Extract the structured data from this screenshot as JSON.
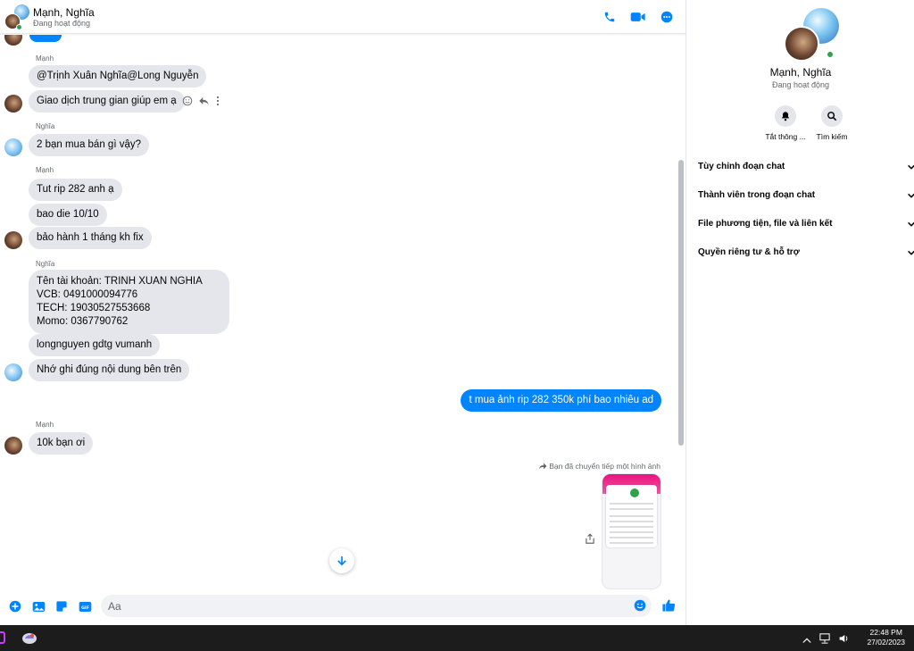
{
  "header": {
    "title": "Mạnh, Nghĩa",
    "status": "Đang hoạt động"
  },
  "messages": {
    "sender_manh": "Mạnh",
    "sender_nghia": "Nghĩa",
    "m1": "@Trịnh Xuân Nghĩa@Long Nguyễn",
    "m2": "Giao dịch trung gian giúp em ạ",
    "m3": "2 bạn mua bán gì vậy?",
    "m4": "Tut rip 282 anh ạ",
    "m5": "bao die 10/10",
    "m6": "bảo hành 1 tháng kh fix",
    "m7": "Tên tài khoản: TRINH XUAN NGHIA\nVCB: 0491000094776\nTECH: 19030527553668\nMomo: 0367790762",
    "m8": "longnguyen gdtg vumanh",
    "m9": "Nhớ ghi đúng nội dung bên trên",
    "m10": "t mua ảnh rip 282 350k phí bao nhiêu ad",
    "m11": "10k bạn ơi",
    "forward_note": "Bạn đã chuyển tiếp một hình ảnh"
  },
  "composer": {
    "placeholder": "Aa"
  },
  "panel": {
    "name": "Mạnh, Nghĩa",
    "status": "Đang hoạt động",
    "mute_label": "Tắt thông ...",
    "search_label": "Tìm kiếm",
    "menu": [
      "Tùy chỉnh đoạn chat",
      "Thành viên trong đoạn chat",
      "File phương tiện, file và liên kết",
      "Quyền riêng tư & hỗ trợ"
    ]
  },
  "taskbar": {
    "time": "22:48 PM",
    "date": "27/02/2023"
  },
  "colors": {
    "accent": "#0084ff",
    "bubble_other": "#e4e6eb",
    "online": "#31a24c"
  }
}
